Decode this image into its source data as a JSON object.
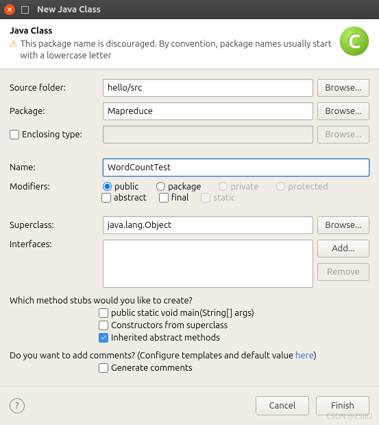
{
  "window": {
    "title": "New Java Class"
  },
  "header": {
    "title": "Java Class",
    "warning": "This package name is discouraged. By convention, package names usually start with a lowercase letter"
  },
  "labels": {
    "source_folder": "Source folder:",
    "package": "Package:",
    "enclosing_type": "Enclosing type:",
    "name": "Name:",
    "modifiers": "Modifiers:",
    "superclass": "Superclass:",
    "interfaces": "Interfaces:"
  },
  "values": {
    "source_folder": "hello/src",
    "package": "Mapreduce",
    "enclosing_type": "",
    "name": "WordCountTest",
    "superclass": "java.lang.Object"
  },
  "buttons": {
    "browse": "Browse...",
    "add": "Add...",
    "remove": "Remove",
    "cancel": "Cancel",
    "finish": "Finish"
  },
  "modifiers": {
    "public": "public",
    "package": "package",
    "private": "private",
    "protected": "protected",
    "abstract": "abstract",
    "final": "final",
    "static": "static"
  },
  "stubs": {
    "question": "Which method stubs would you like to create?",
    "main": "public static void main(String[] args)",
    "constructors": "Constructors from superclass",
    "inherited": "Inherited abstract methods"
  },
  "comments": {
    "question_pre": "Do you want to add comments? (Configure templates and default value ",
    "link": "here",
    "question_post": ")",
    "generate": "Generate comments"
  },
  "watermark": "CSDN @ZSIIIJ"
}
